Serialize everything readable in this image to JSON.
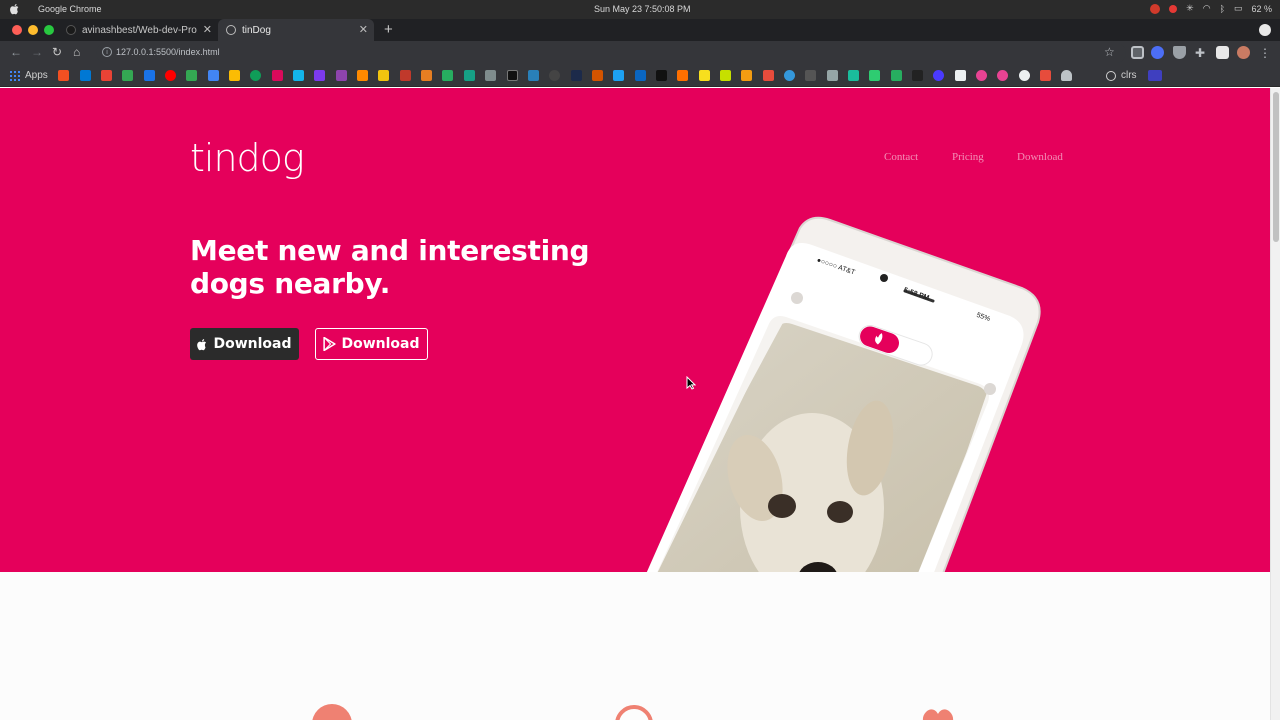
{
  "os_menubar": {
    "app_name": "Google Chrome",
    "clock": "Sun May 23   7:50:08 PM",
    "battery": "62 %"
  },
  "browser": {
    "tabs": [
      {
        "title": "avinashbest/Web-dev-Pro",
        "active": false
      },
      {
        "title": "tinDog",
        "active": true
      }
    ],
    "new_tab_label": "+",
    "url": "127.0.0.1:5500/index.html",
    "bookmarks": {
      "apps_label": "Apps",
      "last_label": "clrs"
    }
  },
  "page": {
    "brand": "tindog",
    "nav": [
      "Contact",
      "Pricing",
      "Download"
    ],
    "headline": "Meet new and interesting dogs nearby.",
    "buttons": {
      "apple_download": "Download",
      "play_download": "Download"
    },
    "phone_status": {
      "carrier": "●○○○○ AT&T",
      "time": "5:58 PM",
      "battery": "55%"
    },
    "colors": {
      "hero_bg": "#e5005b",
      "apple_button_bg": "#2b2b2b",
      "feature_icon": "#ef8172"
    }
  }
}
